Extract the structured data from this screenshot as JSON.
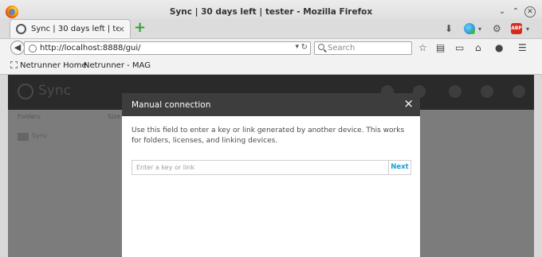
{
  "window": {
    "title": "Sync | 30 days left | tester - Mozilla Firefox"
  },
  "tabs": [
    {
      "label": "Sync | 30 days left | te...",
      "close": "×"
    }
  ],
  "new_tab": "+",
  "nav": {
    "url": "http://localhost:8888/gui/",
    "search_placeholder": "Search"
  },
  "bookmarks": [
    {
      "label": "Netrunner Home"
    },
    {
      "label": "Netrunner - MAG"
    }
  ],
  "page": {
    "logo_text": "Sync",
    "column_1": "Folders",
    "column_2": "Size",
    "row_1": "Sync"
  },
  "modal": {
    "title": "Manual connection",
    "close": "×",
    "description": "Use this field to enter a key or link generated by another device. This works for folders, licenses, and linking devices.",
    "input_placeholder": "Enter a key or link",
    "next_label": "Next"
  },
  "icons": {
    "browser": "firefox-logo-icon",
    "adblock": "ABP"
  },
  "colors": {
    "accent": "#1b9bd6",
    "modal_header": "#3d3d3d",
    "app_header": "#2a2a2a",
    "overlay": "#7c7c7c"
  }
}
